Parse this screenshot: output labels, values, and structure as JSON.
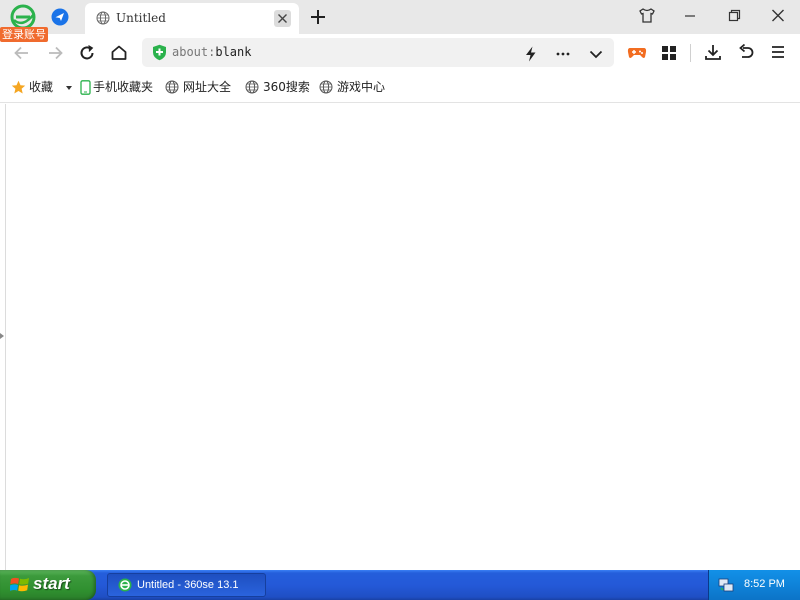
{
  "app": {
    "login_badge": "登录账号",
    "logo_icon": "360se-logo-icon"
  },
  "tab": {
    "title": "Untitled",
    "icon": "globe-icon"
  },
  "address_bar": {
    "scheme": "about:",
    "path": "blank",
    "security_icon": "green-shield-icon"
  },
  "bookmarks": {
    "favorites_label": "收藏",
    "items": [
      {
        "label": "手机收藏夹",
        "icon": "phone-icon"
      },
      {
        "label": "网址大全",
        "icon": "globe-icon"
      },
      {
        "label": "360搜索",
        "icon": "globe-icon"
      },
      {
        "label": "游戏中心",
        "icon": "globe-icon"
      }
    ]
  },
  "taskbar": {
    "start_label": "start",
    "task_label": "Untitled - 360se 13.1",
    "clock": "8:52 PM"
  },
  "colors": {
    "accent_green": "#2bb24c",
    "login_badge_bg": "#f06b2e",
    "taskbar_blue": "#245edb",
    "start_green": "#3c9a3c"
  }
}
